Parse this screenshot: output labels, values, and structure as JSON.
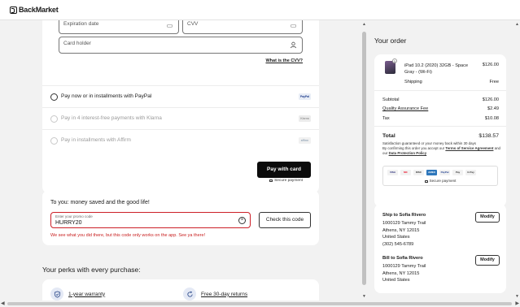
{
  "header": {
    "logo": "BackMarket"
  },
  "payment": {
    "expiry_placeholder": "Expiration date",
    "cvv_placeholder": "CVV",
    "holder_placeholder": "Card holder",
    "cvv_link": "What is the CVV?",
    "options": [
      {
        "label": "Pay now or in installments with PayPal",
        "brand": "PayPal",
        "enabled": true
      },
      {
        "label": "Pay in 4 interest-free payments with Klarna",
        "brand": "Klarna",
        "enabled": false
      },
      {
        "label": "Pay in installments with Affirm",
        "brand": "affirm",
        "enabled": false
      }
    ],
    "pay_button": "Pay with card",
    "secure_label": "Secure payment"
  },
  "promo": {
    "title": "To you: money saved and the good life!",
    "field_label": "Enter your promo code",
    "field_value": "HURRY20",
    "check_button": "Check this code",
    "error": "We see what you did there, but this code only works on the app. See ya there!"
  },
  "perks": {
    "title": "Your perks with every purchase:",
    "items": [
      {
        "label": "1-year warranty",
        "icon": "shield-icon"
      },
      {
        "label": "Free 30-day returns",
        "icon": "return-icon"
      }
    ]
  },
  "order": {
    "title": "Your order",
    "quantity": "1",
    "product_name": "iPad 10.2 (2020) 32GB - Space Gray - (Wi-Fi)",
    "product_price": "$126.00",
    "shipping_label": "Shipping",
    "shipping_value": "Free",
    "subtotal_label": "Subtotal",
    "subtotal_value": "$126.00",
    "qa_label": "Quality Assurance Fee",
    "qa_value": "$2.49",
    "tax_label": "Tax",
    "tax_value": "$10.08",
    "total_label": "Total",
    "total_value": "$138.57",
    "fine_1": "Satisfaction guaranteed or your money back within 30 days",
    "fine_2": "By confirming this order you accept our",
    "fine_terms": "Terms of Service Agreement",
    "fine_3": "and our",
    "fine_privacy": "Data Protection Policy",
    "payment_methods": [
      "VISA",
      "MC",
      "DISC",
      "AMEX",
      "PayPal",
      "Pay",
      "G Pay"
    ],
    "secure_label": "Secure payment"
  },
  "shipping_address": {
    "title": "Ship to Sofia Rivero",
    "lines": [
      "1000129 Tammy Trail",
      "Athens, NY 12015",
      "United States",
      "(302) 545-6789"
    ],
    "modify": "Modify"
  },
  "billing_address": {
    "title": "Bill to Sofia Rivero",
    "lines": [
      "1000129 Tammy Trail",
      "Athens, NY 12015",
      "United States"
    ],
    "modify": "Modify"
  }
}
